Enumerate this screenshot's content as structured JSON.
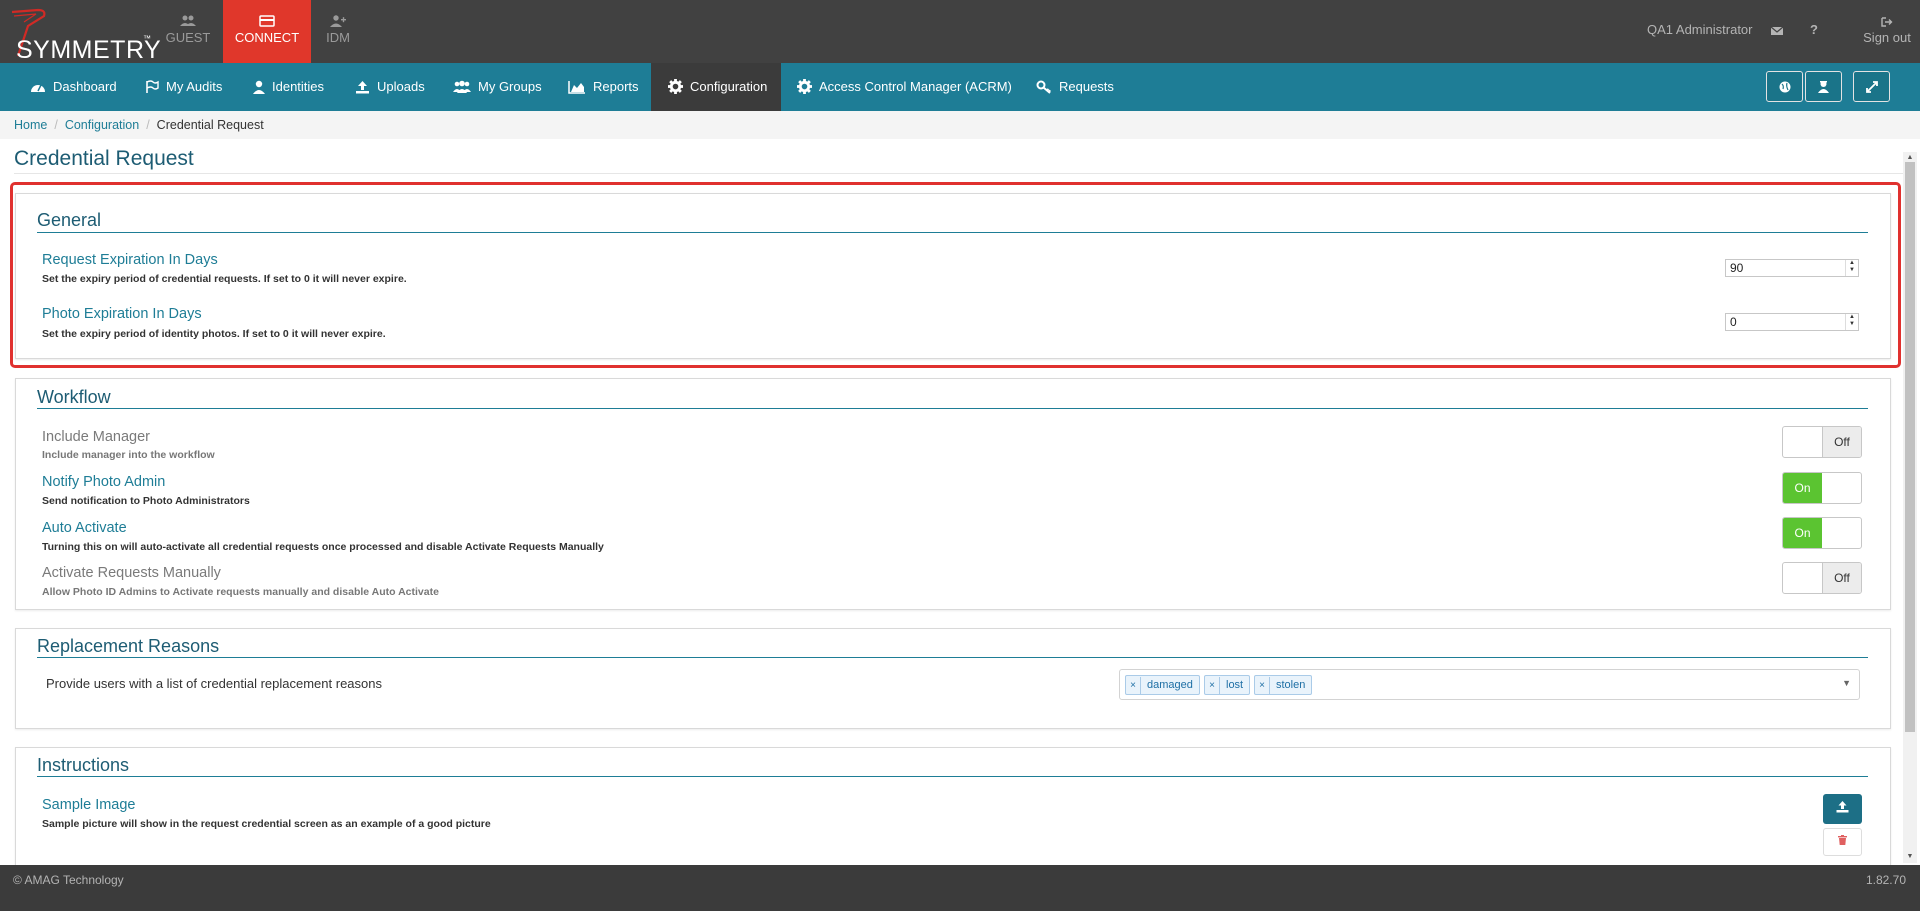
{
  "header": {
    "logo_text": "SYMMETRY",
    "logo_tm": "™",
    "apps": [
      {
        "label": "GUEST",
        "icon": "users-icon"
      },
      {
        "label": "CONNECT",
        "icon": "card-icon"
      },
      {
        "label": "IDM",
        "icon": "user-plus-icon"
      }
    ],
    "user": "QA1 Administrator",
    "help_glyph": "?",
    "sign_out": "Sign out"
  },
  "nav": {
    "items": [
      {
        "label": "Dashboard",
        "icon": "dashboard-icon"
      },
      {
        "label": "My Audits",
        "icon": "flag-icon"
      },
      {
        "label": "Identities",
        "icon": "user-icon"
      },
      {
        "label": "Uploads",
        "icon": "upload-icon"
      },
      {
        "label": "My Groups",
        "icon": "group-icon"
      },
      {
        "label": "Reports",
        "icon": "area-chart-icon"
      },
      {
        "label": "Configuration",
        "icon": "gear-icon"
      },
      {
        "label": "Access Control Manager (ACRM)",
        "icon": "gear-icon"
      },
      {
        "label": "Requests",
        "icon": "key-icon"
      }
    ],
    "active": "Configuration"
  },
  "breadcrumb": {
    "items": [
      "Home",
      "Configuration"
    ],
    "current": "Credential Request"
  },
  "page": {
    "title": "Credential Request"
  },
  "general": {
    "title": "General",
    "settings": [
      {
        "title": "Request Expiration In Days",
        "desc": "Set the expiry period of credential requests. If set to 0 it will never expire.",
        "value": "90"
      },
      {
        "title": "Photo Expiration In Days",
        "desc": "Set the expiry period of identity photos. If set to 0 it will never expire.",
        "value": "0"
      }
    ]
  },
  "workflow": {
    "title": "Workflow",
    "settings": [
      {
        "title": "Include Manager",
        "desc": "Include manager into the workflow",
        "state": "Off"
      },
      {
        "title": "Notify Photo Admin",
        "desc": "Send notification to Photo Administrators",
        "state": "On"
      },
      {
        "title": "Auto Activate",
        "desc": "Turning this on will auto-activate all credential requests once processed and disable Activate Requests Manually",
        "state": "On"
      },
      {
        "title": "Activate Requests Manually",
        "desc": "Allow Photo ID Admins to Activate requests manually and disable Auto Activate",
        "state": "Off"
      }
    ]
  },
  "replacement": {
    "title": "Replacement Reasons",
    "desc": "Provide users with a list of credential replacement reasons",
    "tags": [
      "damaged",
      "lost",
      "stolen"
    ],
    "remove_glyph": "×"
  },
  "instructions": {
    "title": "Instructions",
    "sample_title": "Sample Image",
    "sample_desc": "Sample picture will show in the request credential screen as an example of a good picture"
  },
  "footer": {
    "copyright": "© AMAG Technology",
    "version": "1.82.70"
  },
  "colors": {
    "topbar": "#414141",
    "navbar": "#1e7d96",
    "active_app": "#e0372b",
    "toggle_on": "#5bc431",
    "highlight": "#e0312f"
  }
}
